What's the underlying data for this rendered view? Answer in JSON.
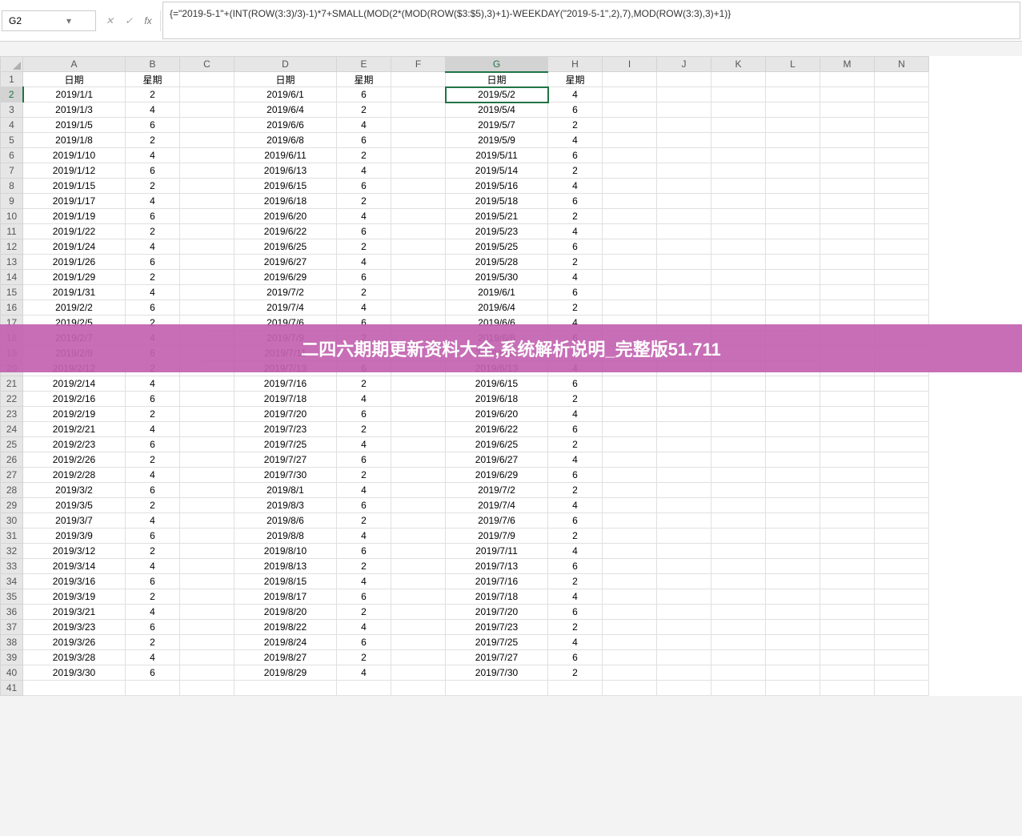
{
  "nameBox": "G2",
  "formula": "{=\"2019-5-1\"+(INT(ROW(3:3)/3)-1)*7+SMALL(MOD(2*(MOD(ROW($3:$5),3)+1)-WEEKDAY(\"2019-5-1\",2),7),MOD(ROW(3:3),3)+1)}",
  "fxLabels": {
    "cancel": "✕",
    "confirm": "✓",
    "fx": "fx"
  },
  "columns": [
    "A",
    "B",
    "C",
    "D",
    "E",
    "F",
    "G",
    "H",
    "I",
    "J",
    "K",
    "L",
    "M",
    "N"
  ],
  "wideCols": [
    0,
    3,
    6
  ],
  "selectedCell": {
    "row": 2,
    "col": "G"
  },
  "bannerText": "二四六期期更新资料大全,系统解析说明_完整版51.711",
  "bannerRows": [
    18,
    19
  ],
  "rows": [
    {
      "n": 1,
      "A": "日期",
      "B": "星期",
      "D": "日期",
      "E": "星期",
      "G": "日期",
      "H": "星期"
    },
    {
      "n": 2,
      "A": "2019/1/1",
      "B": "2",
      "D": "2019/6/1",
      "E": "6",
      "G": "2019/5/2",
      "H": "4"
    },
    {
      "n": 3,
      "A": "2019/1/3",
      "B": "4",
      "D": "2019/6/4",
      "E": "2",
      "G": "2019/5/4",
      "H": "6"
    },
    {
      "n": 4,
      "A": "2019/1/5",
      "B": "6",
      "D": "2019/6/6",
      "E": "4",
      "G": "2019/5/7",
      "H": "2"
    },
    {
      "n": 5,
      "A": "2019/1/8",
      "B": "2",
      "D": "2019/6/8",
      "E": "6",
      "G": "2019/5/9",
      "H": "4"
    },
    {
      "n": 6,
      "A": "2019/1/10",
      "B": "4",
      "D": "2019/6/11",
      "E": "2",
      "G": "2019/5/11",
      "H": "6"
    },
    {
      "n": 7,
      "A": "2019/1/12",
      "B": "6",
      "D": "2019/6/13",
      "E": "4",
      "G": "2019/5/14",
      "H": "2"
    },
    {
      "n": 8,
      "A": "2019/1/15",
      "B": "2",
      "D": "2019/6/15",
      "E": "6",
      "G": "2019/5/16",
      "H": "4"
    },
    {
      "n": 9,
      "A": "2019/1/17",
      "B": "4",
      "D": "2019/6/18",
      "E": "2",
      "G": "2019/5/18",
      "H": "6"
    },
    {
      "n": 10,
      "A": "2019/1/19",
      "B": "6",
      "D": "2019/6/20",
      "E": "4",
      "G": "2019/5/21",
      "H": "2"
    },
    {
      "n": 11,
      "A": "2019/1/22",
      "B": "2",
      "D": "2019/6/22",
      "E": "6",
      "G": "2019/5/23",
      "H": "4"
    },
    {
      "n": 12,
      "A": "2019/1/24",
      "B": "4",
      "D": "2019/6/25",
      "E": "2",
      "G": "2019/5/25",
      "H": "6"
    },
    {
      "n": 13,
      "A": "2019/1/26",
      "B": "6",
      "D": "2019/6/27",
      "E": "4",
      "G": "2019/5/28",
      "H": "2"
    },
    {
      "n": 14,
      "A": "2019/1/29",
      "B": "2",
      "D": "2019/6/29",
      "E": "6",
      "G": "2019/5/30",
      "H": "4"
    },
    {
      "n": 15,
      "A": "2019/1/31",
      "B": "4",
      "D": "2019/7/2",
      "E": "2",
      "G": "2019/6/1",
      "H": "6"
    },
    {
      "n": 16,
      "A": "2019/2/2",
      "B": "6",
      "D": "2019/7/4",
      "E": "4",
      "G": "2019/6/4",
      "H": "2"
    },
    {
      "n": 17,
      "A": "2019/2/5",
      "B": "2",
      "D": "2019/7/6",
      "E": "6",
      "G": "2019/6/6",
      "H": "4"
    },
    {
      "n": 18,
      "A": "2019/2/7",
      "B": "4",
      "D": "2019/7/9",
      "E": "2",
      "G": "2019/6/8",
      "H": "6"
    },
    {
      "n": 19,
      "A": "2019/2/9",
      "B": "6",
      "D": "2019/7/11",
      "E": "4",
      "G": "2019/6/11",
      "H": "2"
    },
    {
      "n": 20,
      "A": "2019/2/12",
      "B": "2",
      "D": "2019/7/13",
      "E": "6",
      "G": "2019/6/13",
      "H": "4"
    },
    {
      "n": 21,
      "A": "2019/2/14",
      "B": "4",
      "D": "2019/7/16",
      "E": "2",
      "G": "2019/6/15",
      "H": "6"
    },
    {
      "n": 22,
      "A": "2019/2/16",
      "B": "6",
      "D": "2019/7/18",
      "E": "4",
      "G": "2019/6/18",
      "H": "2"
    },
    {
      "n": 23,
      "A": "2019/2/19",
      "B": "2",
      "D": "2019/7/20",
      "E": "6",
      "G": "2019/6/20",
      "H": "4"
    },
    {
      "n": 24,
      "A": "2019/2/21",
      "B": "4",
      "D": "2019/7/23",
      "E": "2",
      "G": "2019/6/22",
      "H": "6"
    },
    {
      "n": 25,
      "A": "2019/2/23",
      "B": "6",
      "D": "2019/7/25",
      "E": "4",
      "G": "2019/6/25",
      "H": "2"
    },
    {
      "n": 26,
      "A": "2019/2/26",
      "B": "2",
      "D": "2019/7/27",
      "E": "6",
      "G": "2019/6/27",
      "H": "4"
    },
    {
      "n": 27,
      "A": "2019/2/28",
      "B": "4",
      "D": "2019/7/30",
      "E": "2",
      "G": "2019/6/29",
      "H": "6"
    },
    {
      "n": 28,
      "A": "2019/3/2",
      "B": "6",
      "D": "2019/8/1",
      "E": "4",
      "G": "2019/7/2",
      "H": "2"
    },
    {
      "n": 29,
      "A": "2019/3/5",
      "B": "2",
      "D": "2019/8/3",
      "E": "6",
      "G": "2019/7/4",
      "H": "4"
    },
    {
      "n": 30,
      "A": "2019/3/7",
      "B": "4",
      "D": "2019/8/6",
      "E": "2",
      "G": "2019/7/6",
      "H": "6"
    },
    {
      "n": 31,
      "A": "2019/3/9",
      "B": "6",
      "D": "2019/8/8",
      "E": "4",
      "G": "2019/7/9",
      "H": "2"
    },
    {
      "n": 32,
      "A": "2019/3/12",
      "B": "2",
      "D": "2019/8/10",
      "E": "6",
      "G": "2019/7/11",
      "H": "4"
    },
    {
      "n": 33,
      "A": "2019/3/14",
      "B": "4",
      "D": "2019/8/13",
      "E": "2",
      "G": "2019/7/13",
      "H": "6"
    },
    {
      "n": 34,
      "A": "2019/3/16",
      "B": "6",
      "D": "2019/8/15",
      "E": "4",
      "G": "2019/7/16",
      "H": "2"
    },
    {
      "n": 35,
      "A": "2019/3/19",
      "B": "2",
      "D": "2019/8/17",
      "E": "6",
      "G": "2019/7/18",
      "H": "4"
    },
    {
      "n": 36,
      "A": "2019/3/21",
      "B": "4",
      "D": "2019/8/20",
      "E": "2",
      "G": "2019/7/20",
      "H": "6"
    },
    {
      "n": 37,
      "A": "2019/3/23",
      "B": "6",
      "D": "2019/8/22",
      "E": "4",
      "G": "2019/7/23",
      "H": "2"
    },
    {
      "n": 38,
      "A": "2019/3/26",
      "B": "2",
      "D": "2019/8/24",
      "E": "6",
      "G": "2019/7/25",
      "H": "4"
    },
    {
      "n": 39,
      "A": "2019/3/28",
      "B": "4",
      "D": "2019/8/27",
      "E": "2",
      "G": "2019/7/27",
      "H": "6"
    },
    {
      "n": 40,
      "A": "2019/3/30",
      "B": "6",
      "D": "2019/8/29",
      "E": "4",
      "G": "2019/7/30",
      "H": "2"
    },
    {
      "n": 41
    }
  ]
}
